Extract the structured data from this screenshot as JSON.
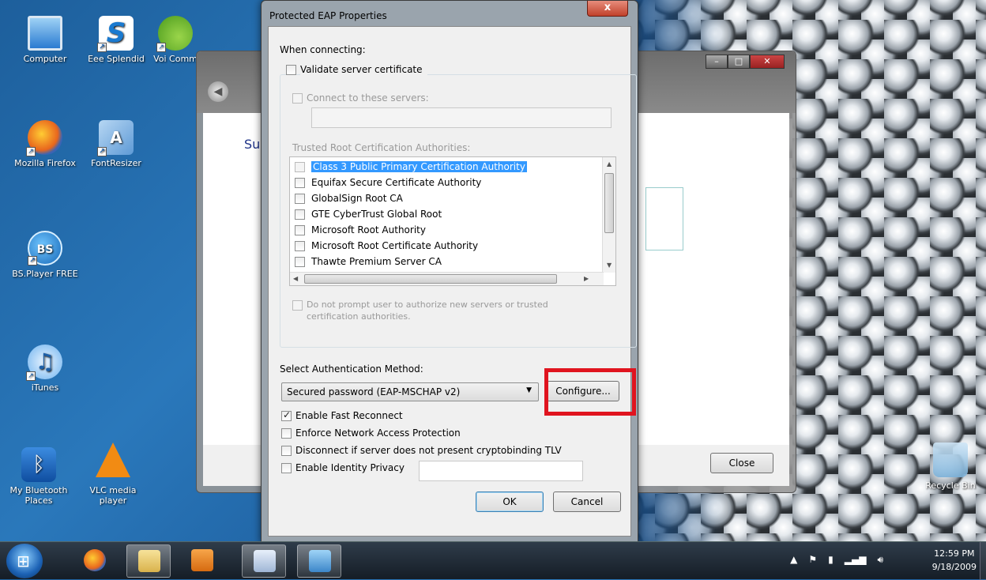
{
  "desktop": {
    "icons": [
      {
        "label": "Computer"
      },
      {
        "label": "Eee Splendid"
      },
      {
        "label": "Voi Comm"
      },
      {
        "label": "Mozilla Firefox"
      },
      {
        "label": "FontResizer"
      },
      {
        "label": "BS.Player FREE"
      },
      {
        "label": "iTunes"
      },
      {
        "label": "My Bluetooth Places"
      },
      {
        "label": "VLC media player"
      },
      {
        "label": "Recycle Bin"
      }
    ]
  },
  "background_window": {
    "heading_partial": "Su",
    "close_label": "Close"
  },
  "dialog": {
    "title": "Protected EAP Properties",
    "close_glyph": "x",
    "when_connecting": "When connecting:",
    "validate_cert": {
      "label": "Validate server certificate",
      "checked": false
    },
    "connect_servers": {
      "label": "Connect to these servers:",
      "checked": false,
      "value": ""
    },
    "trusted_root_label": "Trusted Root Certification Authorities:",
    "cert_list": [
      {
        "label": "Class 3 Public Primary Certification Authority",
        "selected": true
      },
      {
        "label": "Equifax Secure Certificate Authority",
        "selected": false
      },
      {
        "label": "GlobalSign Root CA",
        "selected": false
      },
      {
        "label": "GTE CyberTrust Global Root",
        "selected": false
      },
      {
        "label": "Microsoft Root Authority",
        "selected": false
      },
      {
        "label": "Microsoft Root Certificate Authority",
        "selected": false
      },
      {
        "label": "Thawte Premium Server CA",
        "selected": false
      }
    ],
    "no_prompt": {
      "label_line1": "Do not prompt user to authorize new servers or trusted",
      "label_line2": "certification authorities.",
      "checked": false
    },
    "auth_method_label": "Select Authentication Method:",
    "auth_method_value": "Secured password (EAP-MSCHAP v2)",
    "configure_label": "Configure...",
    "options": [
      {
        "label": "Enable Fast Reconnect",
        "checked": true
      },
      {
        "label": "Enforce Network Access Protection",
        "checked": false
      },
      {
        "label": "Disconnect if server does not present cryptobinding TLV",
        "checked": false
      },
      {
        "label": "Enable Identity Privacy",
        "checked": false
      }
    ],
    "identity_value": "",
    "ok_label": "OK",
    "cancel_label": "Cancel"
  },
  "taskbar": {
    "time": "12:59 PM",
    "date": "9/18/2009"
  },
  "colors": {
    "highlight": "#e0141f",
    "selection": "#3399ff"
  }
}
